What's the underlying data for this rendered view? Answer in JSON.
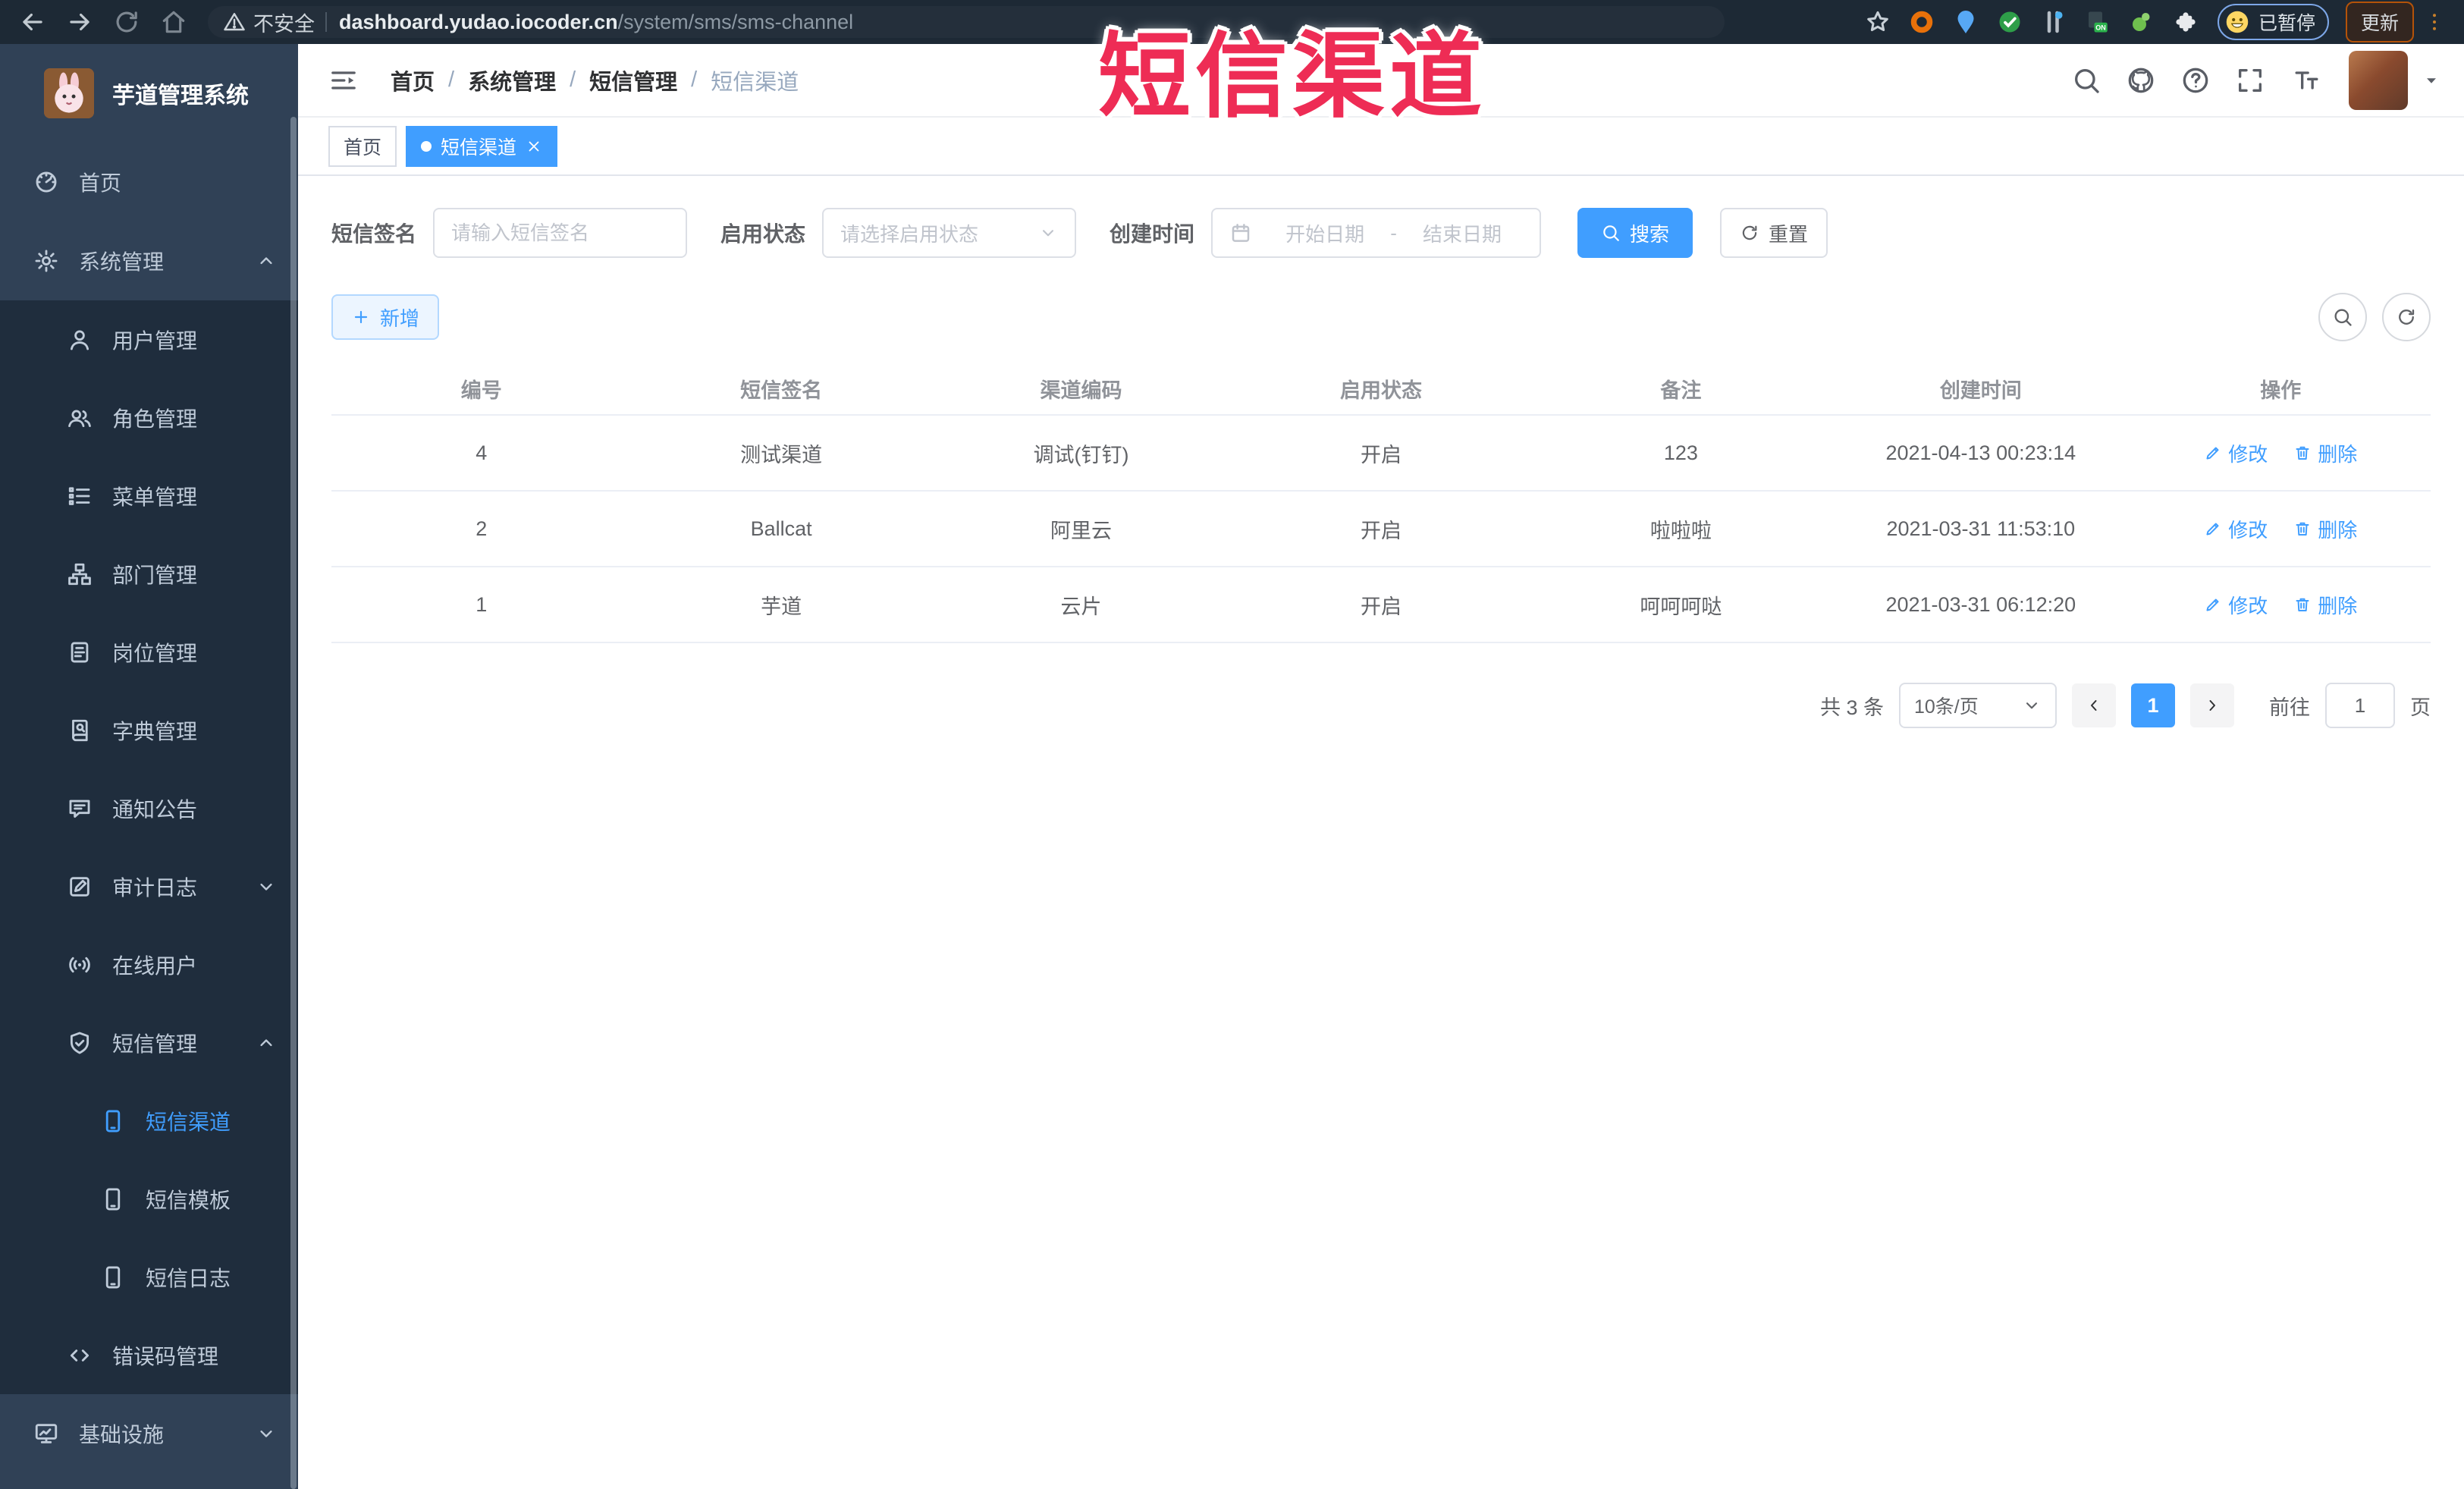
{
  "browser": {
    "security_label": "不安全",
    "url_host": "dashboard.yudao.iocoder.cn",
    "url_path": "/system/sms/sms-channel",
    "paused_label": "已暂停",
    "update_label": "更新"
  },
  "annotation": {
    "text": "短信渠道",
    "color": "#ee2c55"
  },
  "sidebar": {
    "title": "芋道管理系统",
    "menu": [
      {
        "icon": "dashboard-icon",
        "label": "首页",
        "level": 1
      },
      {
        "icon": "gear-icon",
        "label": "系统管理",
        "level": 1,
        "chevron": "up"
      },
      {
        "icon": "user-icon",
        "label": "用户管理",
        "level": 2
      },
      {
        "icon": "users-icon",
        "label": "角色管理",
        "level": 2
      },
      {
        "icon": "menu-list-icon",
        "label": "菜单管理",
        "level": 2
      },
      {
        "icon": "dept-tree-icon",
        "label": "部门管理",
        "level": 2
      },
      {
        "icon": "post-icon",
        "label": "岗位管理",
        "level": 2
      },
      {
        "icon": "dict-icon",
        "label": "字典管理",
        "level": 2
      },
      {
        "icon": "notice-icon",
        "label": "通知公告",
        "level": 2
      },
      {
        "icon": "audit-icon",
        "label": "审计日志",
        "level": 2,
        "chevron": "down"
      },
      {
        "icon": "online-icon",
        "label": "在线用户",
        "level": 2
      },
      {
        "icon": "sms-shield-icon",
        "label": "短信管理",
        "level": 2,
        "chevron": "up"
      },
      {
        "icon": "phone-icon",
        "label": "短信渠道",
        "level": 3,
        "active": true
      },
      {
        "icon": "phone-icon",
        "label": "短信模板",
        "level": 3
      },
      {
        "icon": "phone-icon",
        "label": "短信日志",
        "level": 3
      },
      {
        "icon": "code-icon",
        "label": "错误码管理",
        "level": 2
      },
      {
        "icon": "monitor-icon",
        "label": "基础设施",
        "level": 1,
        "chevron": "down"
      }
    ]
  },
  "breadcrumb": [
    "首页",
    "系统管理",
    "短信管理",
    "短信渠道"
  ],
  "tags": [
    {
      "label": "首页",
      "active": false,
      "closable": false
    },
    {
      "label": "短信渠道",
      "active": true,
      "closable": true
    }
  ],
  "filters": {
    "sign_label": "短信签名",
    "sign_placeholder": "请输入短信签名",
    "status_label": "启用状态",
    "status_placeholder": "请选择启用状态",
    "time_label": "创建时间",
    "start_placeholder": "开始日期",
    "range_separator": "-",
    "end_placeholder": "结束日期",
    "search_label": "搜索",
    "reset_label": "重置"
  },
  "toolbar": {
    "add_label": "新增"
  },
  "table": {
    "headers": [
      "编号",
      "短信签名",
      "渠道编码",
      "启用状态",
      "备注",
      "创建时间",
      "操作"
    ],
    "edit_label": "修改",
    "delete_label": "删除",
    "rows": [
      {
        "id": "4",
        "sign": "测试渠道",
        "code": "调试(钉钉)",
        "status": "开启",
        "remark": "123",
        "created": "2021-04-13 00:23:14"
      },
      {
        "id": "2",
        "sign": "Ballcat",
        "code": "阿里云",
        "status": "开启",
        "remark": "啦啦啦",
        "created": "2021-03-31 11:53:10"
      },
      {
        "id": "1",
        "sign": "芋道",
        "code": "云片",
        "status": "开启",
        "remark": "呵呵呵哒",
        "created": "2021-03-31 06:12:20"
      }
    ]
  },
  "pagination": {
    "total_text": "共 3 条",
    "page_size": "10条/页",
    "current_page": "1",
    "goto_label": "前往",
    "goto_value": "1",
    "page_unit": "页"
  },
  "colors": {
    "accent": "#409eff",
    "sidebar_bg": "#304156",
    "submenu_bg": "#1f2d3d",
    "annotation": "#ee2c55"
  }
}
